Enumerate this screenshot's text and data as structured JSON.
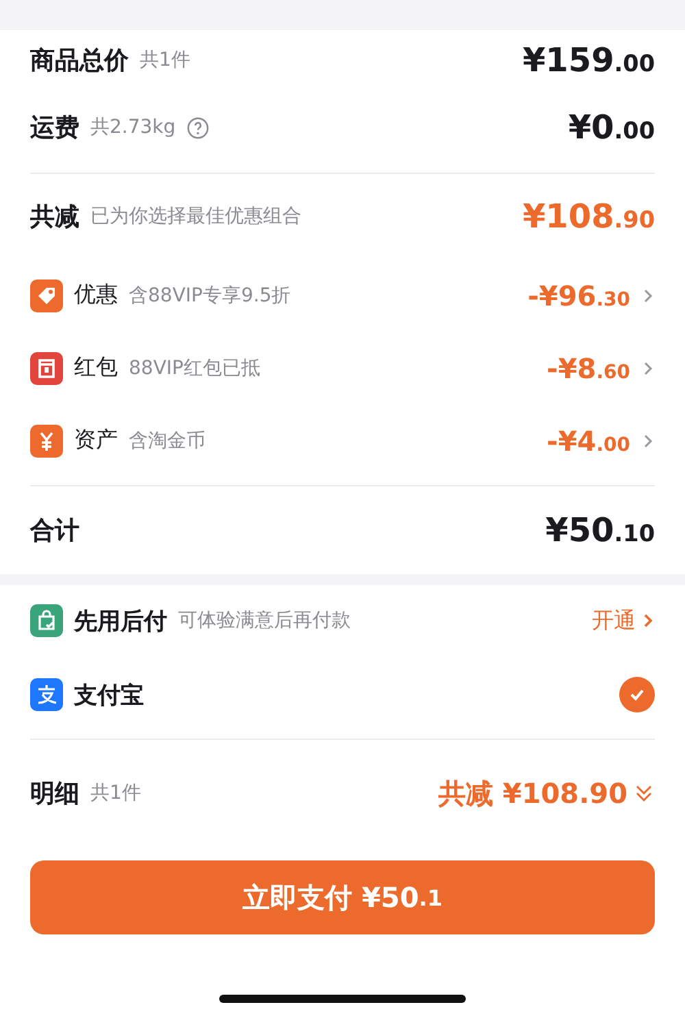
{
  "summary": [
    {
      "label": "商品总价",
      "note": "共1件",
      "amount": "¥159.00",
      "help": false
    },
    {
      "label": "运费",
      "note": "共2.73kg",
      "amount": "¥0.00",
      "help": true
    }
  ],
  "savings": {
    "label": "共减",
    "note": "已为你选择最佳优惠组合",
    "amount": "¥108.90"
  },
  "discounts": [
    {
      "kind": "tag",
      "label": "优惠",
      "note": "含88VIP专享9.5折",
      "amount": "-¥96.30",
      "color": "#ee6a2c"
    },
    {
      "kind": "packet",
      "label": "红包",
      "note": "88VIP红包已抵",
      "amount": "-¥8.60",
      "color": "#e2453c"
    },
    {
      "kind": "yen",
      "label": "资产",
      "note": "含淘金币",
      "amount": "-¥4.00",
      "color": "#ee6a2c"
    }
  ],
  "total": {
    "label": "合计",
    "amount": "¥50.10"
  },
  "payment_methods": [
    {
      "kind": "bag",
      "label": "先用后付",
      "note": "可体验满意后再付款",
      "action": "开通",
      "selected": false
    },
    {
      "kind": "alipay",
      "label": "支付宝",
      "selected": true
    }
  ],
  "detail": {
    "label": "明细",
    "note": "共1件",
    "savings": "共减 ¥108.90"
  },
  "pay_button": "立即支付 ¥50.1"
}
